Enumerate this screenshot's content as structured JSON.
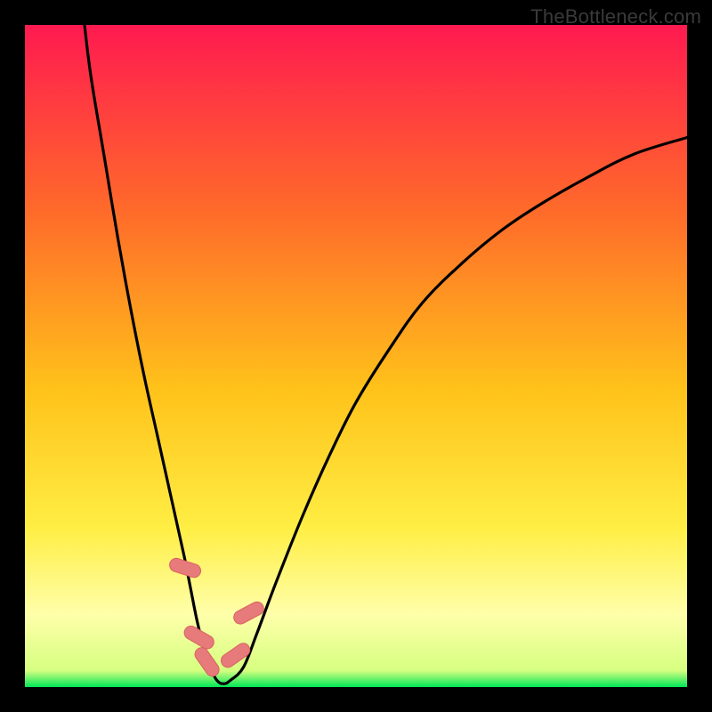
{
  "watermark": "TheBottleneck.com",
  "colors": {
    "page_bg": "#000000",
    "gradient_top": "#ff1a50",
    "gradient_upper_mid": "#ff6a2a",
    "gradient_mid": "#ffc21a",
    "gradient_lower_mid": "#ffee44",
    "gradient_pale": "#ffffaa",
    "gradient_bottom": "#00e756",
    "curve": "#000000",
    "marker_fill": "#e77a7a",
    "marker_stroke": "#d86262"
  },
  "chart_data": {
    "type": "line",
    "title": "",
    "xlabel": "",
    "ylabel": "",
    "xlim": [
      0,
      100
    ],
    "ylim": [
      0,
      100
    ],
    "series": [
      {
        "name": "bottleneck-curve",
        "x": [
          9,
          10,
          12,
          14,
          16,
          18,
          20,
          22,
          24,
          25,
          26,
          27,
          28,
          29,
          30,
          31,
          33,
          35,
          38,
          42,
          46,
          50,
          55,
          60,
          66,
          72,
          78,
          85,
          92,
          100
        ],
        "y": [
          100,
          92,
          80,
          68,
          57,
          47,
          38,
          29,
          20,
          15,
          10,
          6,
          3,
          1,
          0.5,
          1,
          3,
          8,
          16,
          26,
          35,
          43,
          51,
          58,
          64,
          69,
          73,
          77,
          80.5,
          83
        ]
      }
    ],
    "markers": [
      {
        "x": 24.2,
        "y": 18,
        "rot": -72
      },
      {
        "x": 26.3,
        "y": 7.5,
        "rot": -60
      },
      {
        "x": 27.5,
        "y": 3.8,
        "rot": -35
      },
      {
        "x": 31.8,
        "y": 4.8,
        "rot": 55
      },
      {
        "x": 33.8,
        "y": 11.2,
        "rot": 62
      }
    ]
  }
}
